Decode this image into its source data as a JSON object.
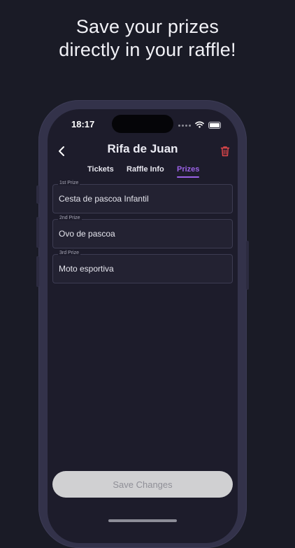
{
  "headline": {
    "line1": "Save your prizes",
    "line2": "directly in your raffle!"
  },
  "status_bar": {
    "time": "18:17"
  },
  "nav": {
    "title": "Rifa de Juan",
    "back_icon": "chevron-left-icon",
    "delete_icon": "trash-icon",
    "delete_color": "#e0474b"
  },
  "tabs": [
    {
      "label": "Tickets",
      "active": false
    },
    {
      "label": "Raffle Info",
      "active": false
    },
    {
      "label": "Prizes",
      "active": true
    }
  ],
  "prizes": [
    {
      "label": "1st Prize",
      "value": "Cesta de pascoa Infantil"
    },
    {
      "label": "2nd Prize",
      "value": "Ovo de pascoa"
    },
    {
      "label": "3rd Prize",
      "value": "Moto esportiva"
    }
  ],
  "save_button": {
    "label": "Save Changes"
  },
  "colors": {
    "accent": "#9b62e6",
    "background": "#1a1b26"
  }
}
